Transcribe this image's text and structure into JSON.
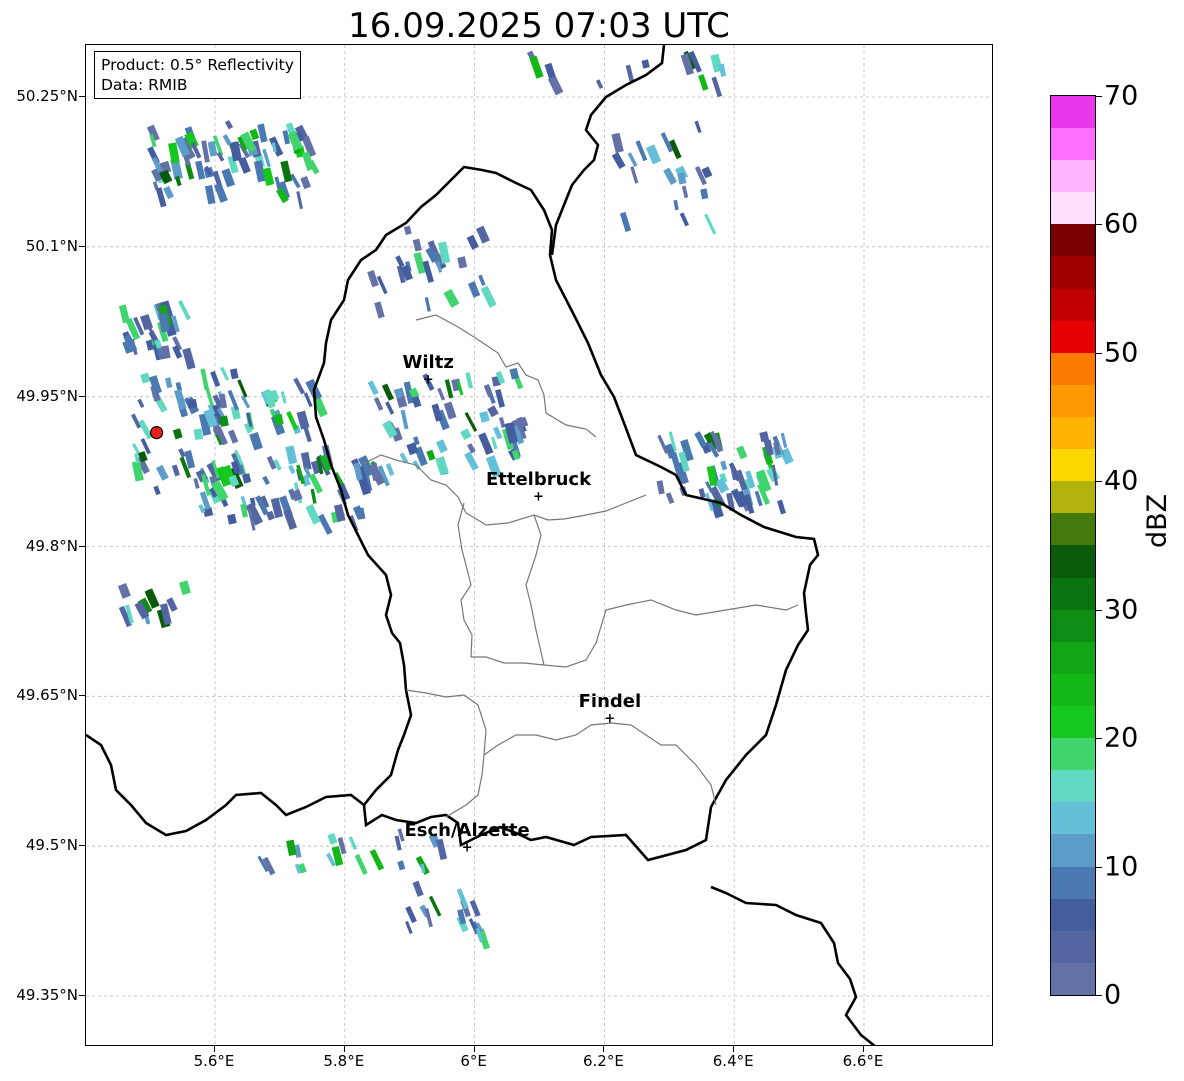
{
  "title": "16.09.2025 07:03 UTC",
  "info_box": {
    "product": "Product: 0.5° Reflectivity",
    "data": "Data: RMIB"
  },
  "map": {
    "lon_range": [
      5.4,
      6.8
    ],
    "lat_range": [
      49.3,
      50.3
    ],
    "lat_ticks": [
      {
        "value": 50.25,
        "label": "50.25°N"
      },
      {
        "value": 50.1,
        "label": "50.1°N"
      },
      {
        "value": 49.95,
        "label": "49.95°N"
      },
      {
        "value": 49.8,
        "label": "49.8°N"
      },
      {
        "value": 49.65,
        "label": "49.65°N"
      },
      {
        "value": 49.5,
        "label": "49.5°N"
      },
      {
        "value": 49.35,
        "label": "49.35°N"
      }
    ],
    "lon_ticks": [
      {
        "value": 5.6,
        "label": "5.6°E"
      },
      {
        "value": 5.8,
        "label": "5.8°E"
      },
      {
        "value": 6.0,
        "label": "6°E"
      },
      {
        "value": 6.2,
        "label": "6.2°E"
      },
      {
        "value": 6.4,
        "label": "6.4°E"
      },
      {
        "value": 6.6,
        "label": "6.6°E"
      }
    ],
    "gridlines": true,
    "cities": [
      {
        "name": "Wiltz",
        "lon": 5.93,
        "lat": 49.966
      },
      {
        "name": "Ettelbruck",
        "lon": 6.1,
        "lat": 49.849
      },
      {
        "name": "Findel",
        "lon": 6.21,
        "lat": 49.626
      },
      {
        "name": "Esch/Alzette",
        "lon": 5.99,
        "lat": 49.497
      }
    ],
    "radar_site": {
      "lon": 5.51,
      "lat": 49.914,
      "color": "#e8201c"
    },
    "reflectivity_clusters": [
      {
        "lon": 5.62,
        "lat": 50.19,
        "w": 0.25,
        "h": 0.07,
        "n": 70
      },
      {
        "lon": 5.5,
        "lat": 50.02,
        "w": 0.1,
        "h": 0.05,
        "n": 30
      },
      {
        "lon": 5.62,
        "lat": 49.93,
        "w": 0.3,
        "h": 0.1,
        "n": 80
      },
      {
        "lon": 5.68,
        "lat": 49.86,
        "w": 0.35,
        "h": 0.06,
        "n": 70
      },
      {
        "lon": 5.95,
        "lat": 49.93,
        "w": 0.25,
        "h": 0.1,
        "n": 60
      },
      {
        "lon": 5.92,
        "lat": 50.08,
        "w": 0.18,
        "h": 0.08,
        "n": 25
      },
      {
        "lon": 6.38,
        "lat": 49.88,
        "w": 0.2,
        "h": 0.07,
        "n": 60
      },
      {
        "lon": 6.28,
        "lat": 50.18,
        "w": 0.15,
        "h": 0.1,
        "n": 20
      },
      {
        "lon": 5.5,
        "lat": 49.75,
        "w": 0.1,
        "h": 0.03,
        "n": 12
      },
      {
        "lon": 5.8,
        "lat": 49.5,
        "w": 0.3,
        "h": 0.04,
        "n": 20
      },
      {
        "lon": 5.95,
        "lat": 49.44,
        "w": 0.12,
        "h": 0.05,
        "n": 16
      },
      {
        "lon": 6.23,
        "lat": 50.28,
        "w": 0.3,
        "h": 0.03,
        "n": 14
      }
    ]
  },
  "colorbar": {
    "label": "dBZ",
    "ticks": [
      {
        "value": 0,
        "label": "0"
      },
      {
        "value": 10,
        "label": "10"
      },
      {
        "value": 20,
        "label": "20"
      },
      {
        "value": 30,
        "label": "30"
      },
      {
        "value": 40,
        "label": "40"
      },
      {
        "value": 50,
        "label": "50"
      },
      {
        "value": 60,
        "label": "60"
      },
      {
        "value": 70,
        "label": "70"
      }
    ],
    "range": [
      0,
      70
    ],
    "colors": [
      "#6471a7",
      "#5466a2",
      "#445d9f",
      "#4a78b0",
      "#5b9cc8",
      "#64bfd8",
      "#60d8c2",
      "#3fd46c",
      "#14c81e",
      "#13b818",
      "#12a516",
      "#0e8d14",
      "#0a7510",
      "#0a5a0c",
      "#447a0c",
      "#b1b20a",
      "#fed701",
      "#feb401",
      "#fe9901",
      "#fe7b01",
      "#e60000",
      "#c00000",
      "#a00000",
      "#780000",
      "#ffe0ff",
      "#ffb4ff",
      "#ff6eff",
      "#ea36ea"
    ]
  }
}
